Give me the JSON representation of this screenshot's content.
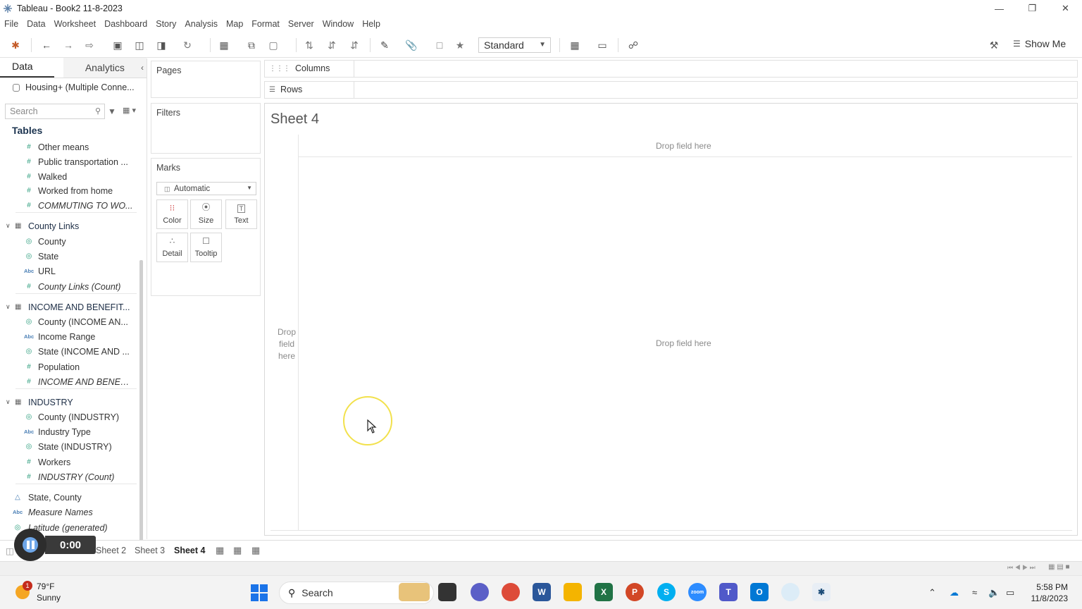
{
  "window": {
    "title": "Tableau - Book2 11-8-2023"
  },
  "menu": [
    "File",
    "Data",
    "Worksheet",
    "Dashboard",
    "Story",
    "Analysis",
    "Map",
    "Format",
    "Server",
    "Window",
    "Help"
  ],
  "toolbar": {
    "fit_select": "Standard",
    "show_me": "Show Me"
  },
  "datapane": {
    "tab_data": "Data",
    "tab_analytics": "Analytics",
    "datasource": "Housing+ (Multiple Conne...",
    "search_placeholder": "Search",
    "tables_header": "Tables",
    "items": [
      {
        "label": "Other means",
        "kind": "measure"
      },
      {
        "label": "Public transportation ...",
        "kind": "measure"
      },
      {
        "label": "Walked",
        "kind": "measure"
      },
      {
        "label": "Worked from home",
        "kind": "measure"
      },
      {
        "label": "COMMUTING TO WO...",
        "kind": "measure-italic"
      },
      {
        "label": "County Links",
        "kind": "group"
      },
      {
        "label": "County",
        "kind": "geo"
      },
      {
        "label": "State",
        "kind": "geo"
      },
      {
        "label": "URL",
        "kind": "abc"
      },
      {
        "label": "County Links (Count)",
        "kind": "measure-italic"
      },
      {
        "label": "INCOME AND BENEFIT...",
        "kind": "group"
      },
      {
        "label": "County (INCOME AN...",
        "kind": "geo"
      },
      {
        "label": "Income Range",
        "kind": "abc"
      },
      {
        "label": "State (INCOME AND ...",
        "kind": "geo"
      },
      {
        "label": "Population",
        "kind": "measure"
      },
      {
        "label": "INCOME AND BENEFI...",
        "kind": "measure-italic"
      },
      {
        "label": "INDUSTRY",
        "kind": "group"
      },
      {
        "label": "County (INDUSTRY)",
        "kind": "geo"
      },
      {
        "label": "Industry Type",
        "kind": "abc"
      },
      {
        "label": "State (INDUSTRY)",
        "kind": "geo"
      },
      {
        "label": "Workers",
        "kind": "measure"
      },
      {
        "label": "INDUSTRY (Count)",
        "kind": "measure-italic"
      },
      {
        "label": "State, County",
        "kind": "hierarchy"
      },
      {
        "label": "Measure Names",
        "kind": "abc-italic"
      },
      {
        "label": "Latitude (generated)",
        "kind": "geo-italic"
      }
    ]
  },
  "shelves": {
    "pages": "Pages",
    "filters": "Filters",
    "marks": "Marks",
    "marks_type": "Automatic",
    "columns": "Columns",
    "rows": "Rows",
    "mark_buttons": [
      "Color",
      "Size",
      "Text",
      "Detail",
      "Tooltip"
    ]
  },
  "sheet": {
    "title": "Sheet 4",
    "drop_top": "Drop field here",
    "drop_left": "Drop field here",
    "drop_center": "Drop field here"
  },
  "sheet_tabs": [
    "Sheet 2",
    "Sheet 3",
    "Sheet 4"
  ],
  "active_sheet": "Sheet 4",
  "recorder": {
    "time": "0:00"
  },
  "taskbar": {
    "weather_temp": "79°F",
    "weather_desc": "Sunny",
    "weather_badge": "1",
    "search_label": "Search",
    "time": "5:58 PM",
    "date": "11/8/2023"
  }
}
